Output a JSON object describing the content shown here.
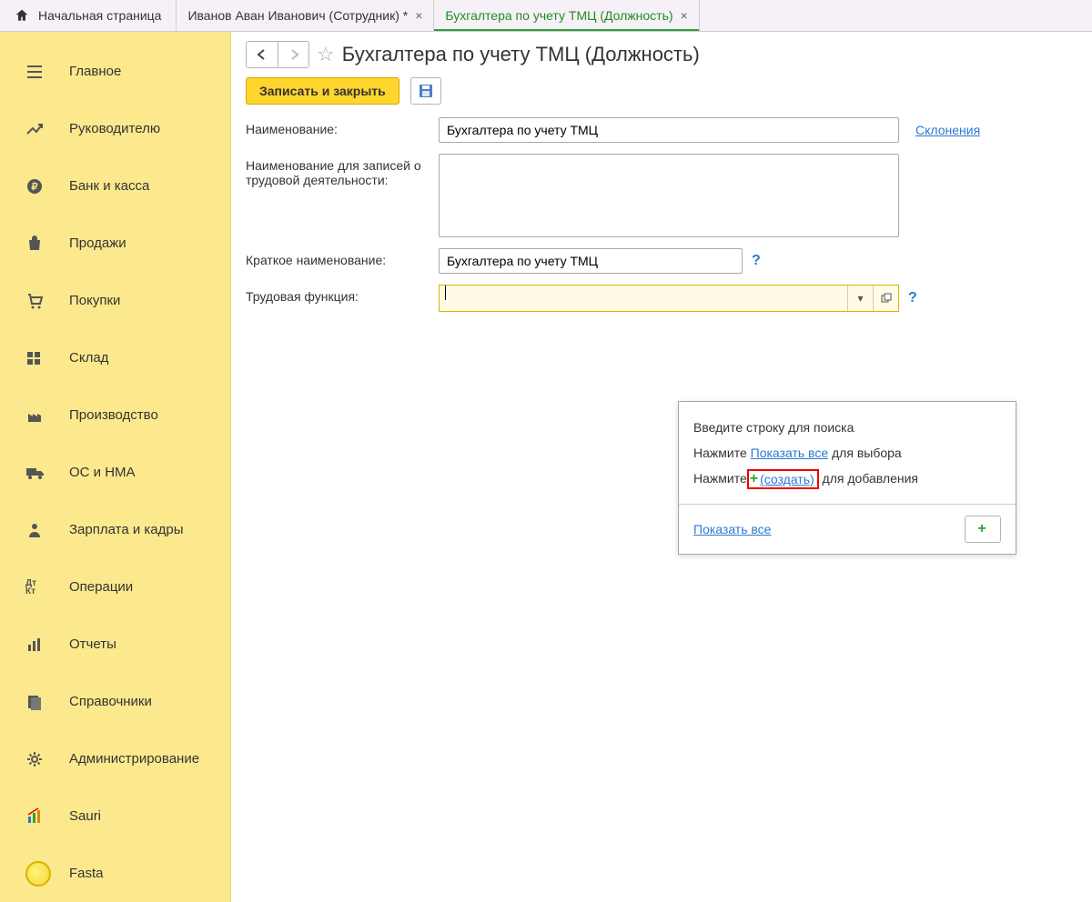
{
  "tabs": {
    "home": "Начальная страница",
    "t1": "Иванов Аван Иванович (Сотрудник) *",
    "t2": "Бухгалтера по учету ТМЦ (Должность)"
  },
  "sidebar": {
    "items": [
      {
        "label": "Главное",
        "icon": "menu"
      },
      {
        "label": "Руководителю",
        "icon": "trend"
      },
      {
        "label": "Банк и касса",
        "icon": "ruble"
      },
      {
        "label": "Продажи",
        "icon": "bag"
      },
      {
        "label": "Покупки",
        "icon": "cart"
      },
      {
        "label": "Склад",
        "icon": "grid"
      },
      {
        "label": "Производство",
        "icon": "factory"
      },
      {
        "label": "ОС и НМА",
        "icon": "truck"
      },
      {
        "label": "Зарплата и кадры",
        "icon": "person"
      },
      {
        "label": "Операции",
        "icon": "dtkt"
      },
      {
        "label": "Отчеты",
        "icon": "bars"
      },
      {
        "label": "Справочники",
        "icon": "books"
      },
      {
        "label": "Администрирование",
        "icon": "gear"
      },
      {
        "label": "Sauri",
        "icon": "sauri"
      },
      {
        "label": "Fasta",
        "icon": "coin"
      }
    ]
  },
  "page": {
    "title": "Бухгалтера по учету ТМЦ (Должность)"
  },
  "actions": {
    "save_close": "Записать и закрыть"
  },
  "form": {
    "name_label": "Наименование:",
    "name_value": "Бухгалтера по учету ТМЦ",
    "declensions_link": "Склонения",
    "name2_label": "Наименование для записей о трудовой деятельности:",
    "name2_value": "",
    "shortname_label": "Краткое наименование:",
    "shortname_value": "Бухгалтера по учету ТМЦ",
    "func_label": "Трудовая функция:",
    "func_value": ""
  },
  "dropdown": {
    "line1": "Введите строку для поиска",
    "line2a": "Нажмите ",
    "line2b": "Показать все",
    "line2c": " для выбора",
    "line3a": "Нажмите",
    "create_link": " (создать)",
    "line3c": " для добавления",
    "show_all": "Показать все"
  }
}
